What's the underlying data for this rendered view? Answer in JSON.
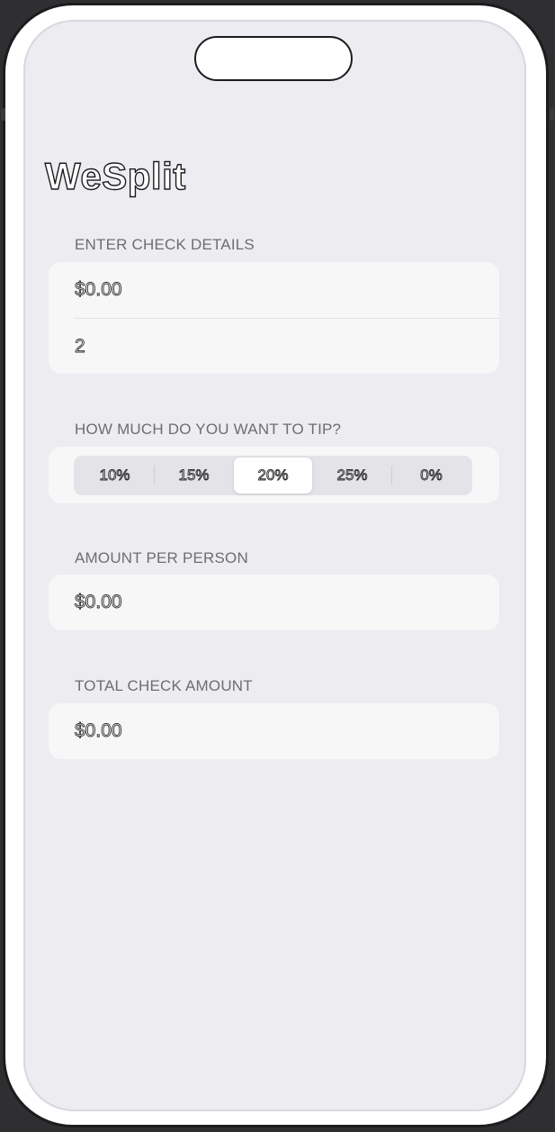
{
  "app": {
    "title": "WeSplit"
  },
  "check_details": {
    "header": "ENTER CHECK DETAILS",
    "amount_value": "$0.00",
    "people_value": "2"
  },
  "tip": {
    "header": "HOW MUCH DO YOU WANT TO TIP?",
    "options": [
      "10%",
      "15%",
      "20%",
      "25%",
      "0%"
    ],
    "selected": "20%"
  },
  "per_person": {
    "header": "AMOUNT PER PERSON",
    "value": "$0.00"
  },
  "total": {
    "header": "TOTAL CHECK AMOUNT",
    "value": "$0.00"
  }
}
